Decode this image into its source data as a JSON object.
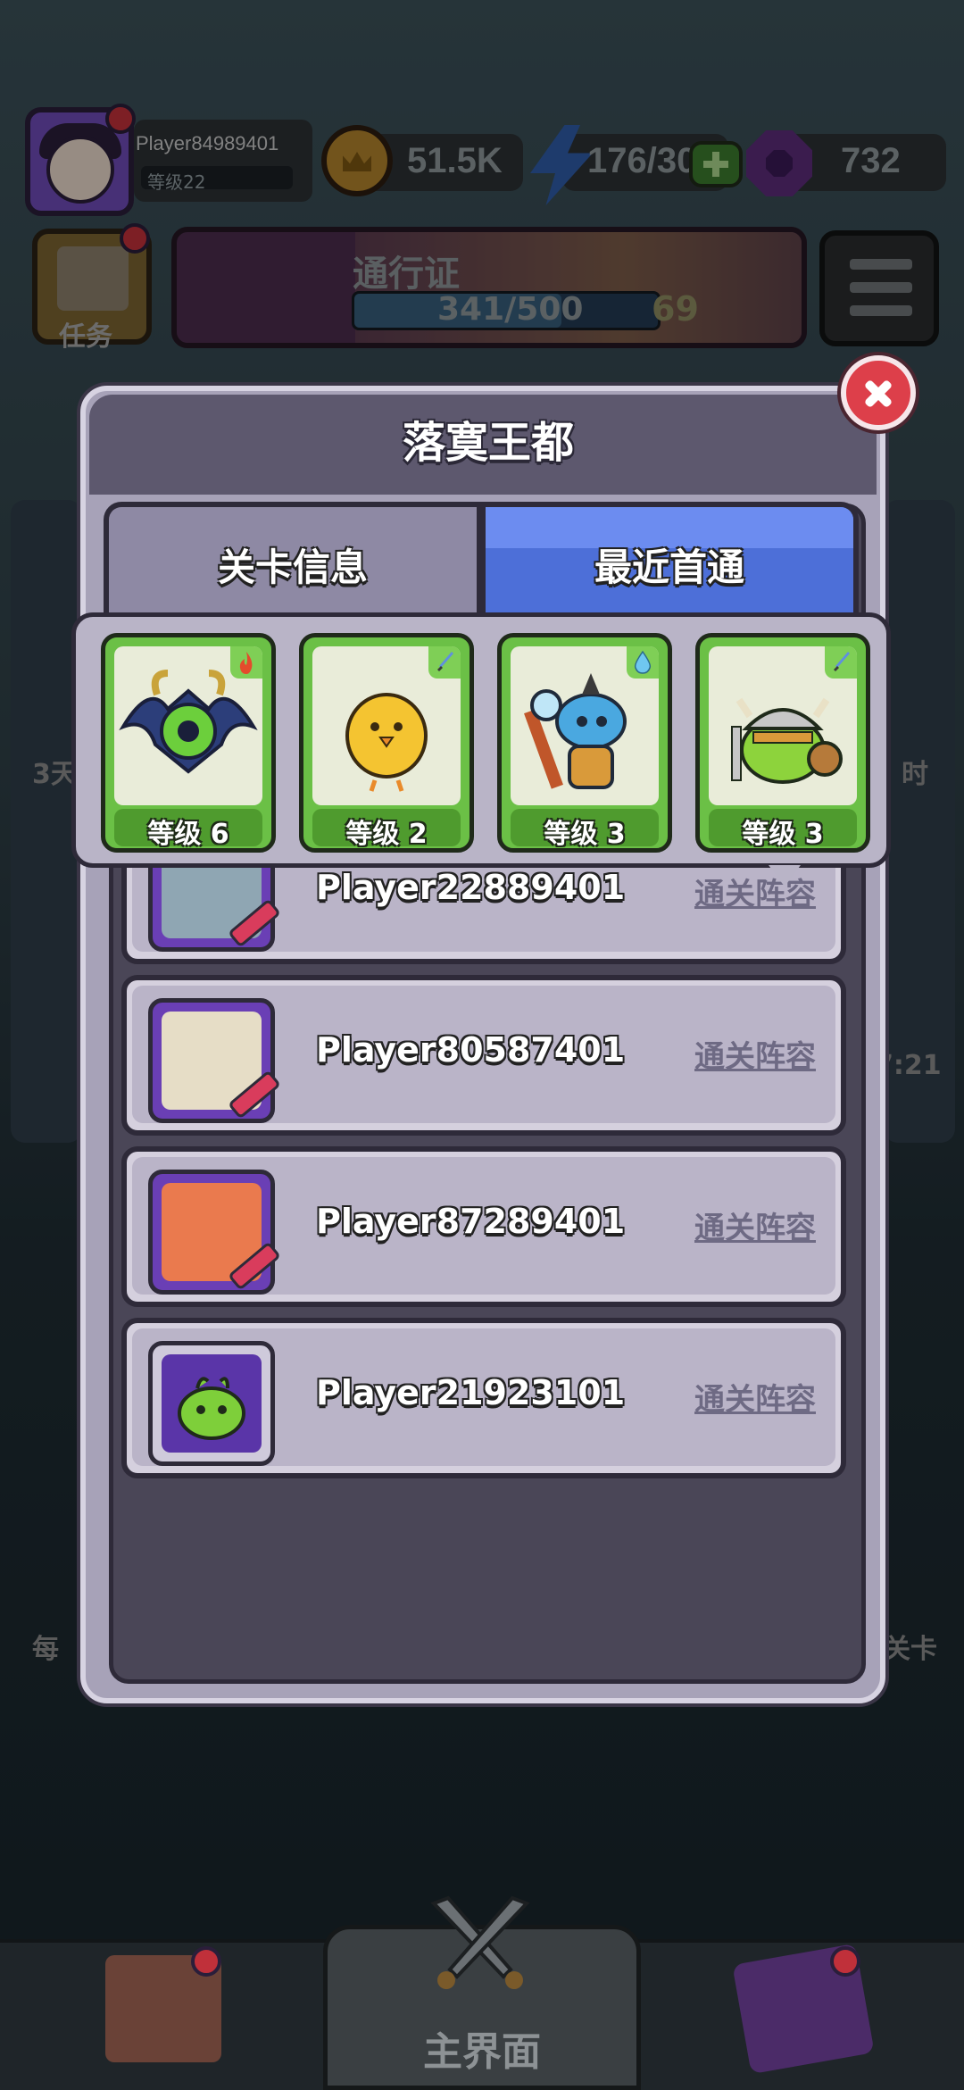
{
  "hud": {
    "player_name": "Player84989401",
    "player_level": "等级22",
    "gold": "51.5K",
    "energy": "176/30",
    "gems": "732",
    "task_label": "任务",
    "pass_title": "通行证",
    "pass_progress": "341/500",
    "pass_progress_ratio": 0.682,
    "pass_level": "69"
  },
  "side": {
    "left_label_1": "3天",
    "right_label_1": "时",
    "right_label_2": "7:21",
    "left_label_bottom": "每",
    "right_label_bottom": "关卡"
  },
  "modal": {
    "title": "落寞王都",
    "tabs": [
      {
        "label": "关卡信息",
        "active": false
      },
      {
        "label": "最近首通",
        "active": true
      }
    ],
    "accent_active_tab": "#4d6fd8"
  },
  "popup": {
    "cards": [
      {
        "level": "等级 6",
        "element": "fire-icon",
        "creature": "bat-demon"
      },
      {
        "level": "等级 2",
        "element": "sword-icon",
        "creature": "chick"
      },
      {
        "level": "等级 3",
        "element": "water-drop-icon",
        "creature": "blue-imp"
      },
      {
        "level": "等级 3",
        "element": "sword-icon",
        "creature": "slime-viking"
      }
    ]
  },
  "rows": [
    {
      "name": "Player22889401",
      "link": "通关阵容",
      "avatar": "ghost-avatar"
    },
    {
      "name": "Player80587401",
      "link": "通关阵容",
      "avatar": "priestess-avatar"
    },
    {
      "name": "Player87289401",
      "link": "通关阵容",
      "avatar": "imp-avatar"
    },
    {
      "name": "Player21923101",
      "link": "通关阵容",
      "avatar": "slime-avatar"
    }
  ],
  "bottom_nav": {
    "main_label": "主界面"
  }
}
